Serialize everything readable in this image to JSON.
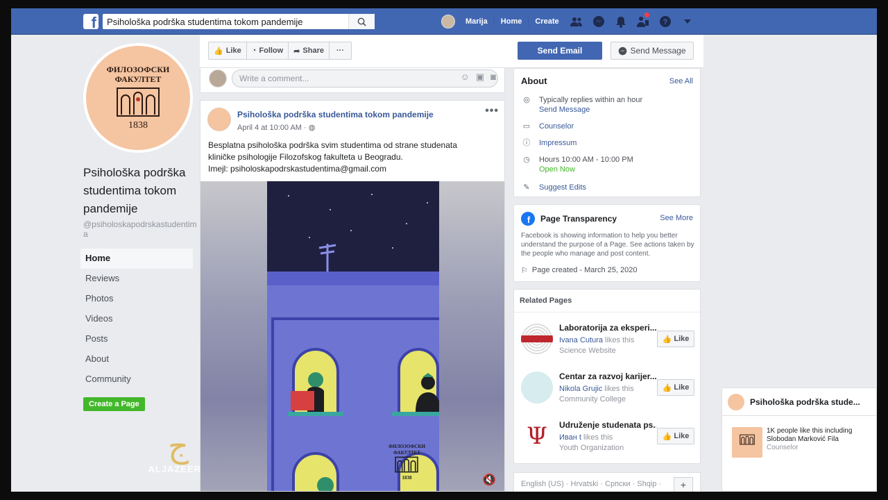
{
  "topbar": {
    "logo": "f",
    "search_value": "Psihološka podrška studentima tokom pandemije",
    "user_name": "Marija",
    "home": "Home",
    "create": "Create"
  },
  "profile": {
    "logo_line1": "ФИЛОЗОФСКИ",
    "logo_line2": "ФАКУЛТЕТ",
    "logo_year": "1838",
    "page_name": "Psihološka podrška studentima tokom pandemije",
    "handle": "@psiholoskapodrskastudentima"
  },
  "side_nav": [
    "Home",
    "Reviews",
    "Photos",
    "Videos",
    "Posts",
    "About",
    "Community"
  ],
  "create_page": "Create a Page",
  "watermark": {
    "brand": "ALJAZEERA"
  },
  "actions": {
    "like": "Like",
    "follow": "Follow",
    "share": "Share",
    "more": "···",
    "send_email": "Send Email",
    "send_message": "Send Message"
  },
  "comment": {
    "placeholder": "Write a comment..."
  },
  "post": {
    "title": "Psihološka podrška studentima tokom pandemije",
    "time": "April 4 at 10:00 AM · ",
    "line1": "Besplatna psihološka podrška svim studentima od strane studenata",
    "line2": "kliničke psihologije Filozofskog fakulteta u Beogradu.",
    "line3": "Imejl: psiholoskapodrskastudentima@gmail.com",
    "art_logo1": "ФИЛОЗОФСКИ",
    "art_logo2": "ФАКУЛТЕТ",
    "art_year": "1838"
  },
  "about": {
    "title": "About",
    "see_all": "See All",
    "replies": "Typically replies within an hour",
    "send_message": "Send Message",
    "category": "Counselor",
    "impressum": "Impressum",
    "hours": "Hours 10:00 AM - 10:00 PM",
    "open_now": "Open Now",
    "suggest": "Suggest Edits"
  },
  "transparency": {
    "title": "Page Transparency",
    "see_more": "See More",
    "text": "Facebook is showing information to help you better understand the purpose of a Page. See actions taken by the people who manage and post content.",
    "created": "Page created - March 25, 2020"
  },
  "related": {
    "title": "Related Pages",
    "items": [
      {
        "name": "Laboratorija za eksperi...",
        "friend": "Ivana Cutura",
        "likes": " likes this",
        "category": "Science Website",
        "like": "Like"
      },
      {
        "name": "Centar za razvoj karijer...",
        "friend": "Nikola Grujic",
        "likes": " likes this",
        "category": "Community College",
        "like": "Like"
      },
      {
        "name": "Udruženje studenata ps...",
        "friend": "Иван t",
        "likes": " likes this",
        "category": "Youth Organization",
        "like": "Like"
      }
    ]
  },
  "languages": "English (US) · Hrvatski · Српски · Shqip ·",
  "chat": {
    "title": "Psihološka podrška stude...",
    "likes": "1K people like this including Slobodan Marković Fila",
    "category": "Counselor"
  }
}
